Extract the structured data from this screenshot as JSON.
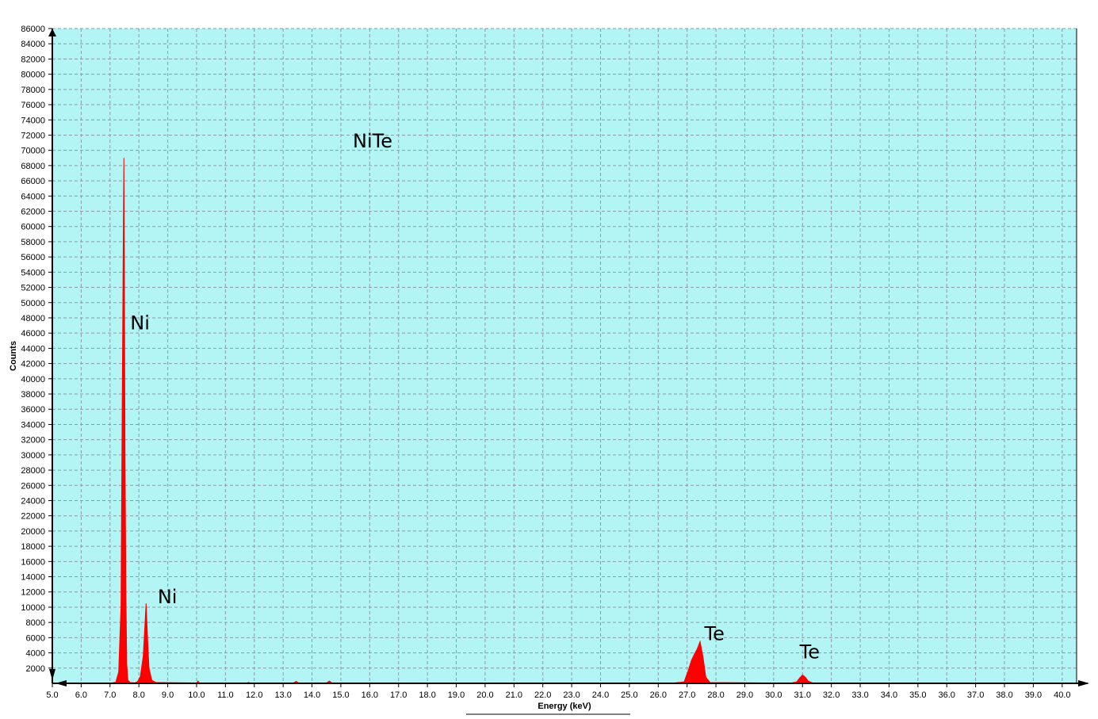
{
  "chart_data": {
    "type": "area",
    "title": "NiTe",
    "xlabel": "Energy (keV)",
    "ylabel": "Counts",
    "xlim": [
      5.0,
      40.5
    ],
    "ylim": [
      0,
      86000
    ],
    "grid": true,
    "plot_background": "#b3f5f5",
    "series_color": "#ff0000",
    "grid_color": "#8a9aa8",
    "x_ticks": [
      5.0,
      6.0,
      7.0,
      8.0,
      9.0,
      10.0,
      11.0,
      12.0,
      13.0,
      14.0,
      15.0,
      16.0,
      17.0,
      18.0,
      19.0,
      20.0,
      21.0,
      22.0,
      23.0,
      24.0,
      25.0,
      26.0,
      27.0,
      28.0,
      29.0,
      30.0,
      31.0,
      32.0,
      33.0,
      34.0,
      35.0,
      36.0,
      37.0,
      38.0,
      39.0,
      40.0
    ],
    "x_tick_labels": [
      "5.0",
      "6.0",
      "7.0",
      "8.0",
      "9.0",
      "10.0",
      "11.0",
      "12.0",
      "13.0",
      "14.0",
      "15.0",
      "16.0",
      "17.0",
      "18.0",
      "19.0",
      "20.0",
      "21.0",
      "22.0",
      "23.0",
      "24.0",
      "25.0",
      "26.0",
      "27.0",
      "28.0",
      "29.0",
      "30.0",
      "31.0",
      "32.0",
      "33.0",
      "34.0",
      "35.0",
      "36.0",
      "37.0",
      "38.0",
      "39.0",
      "40.0"
    ],
    "y_ticks": [
      2000,
      4000,
      6000,
      8000,
      10000,
      12000,
      14000,
      16000,
      18000,
      20000,
      22000,
      24000,
      26000,
      28000,
      30000,
      32000,
      34000,
      36000,
      38000,
      40000,
      42000,
      44000,
      46000,
      48000,
      50000,
      52000,
      54000,
      56000,
      58000,
      60000,
      62000,
      64000,
      66000,
      68000,
      70000,
      72000,
      74000,
      76000,
      78000,
      80000,
      82000,
      84000,
      86000
    ],
    "y_tick_labels": [
      "2000",
      "4000",
      "6000",
      "8000",
      "10000",
      "12000",
      "14000",
      "16000",
      "18000",
      "20000",
      "22000",
      "24000",
      "26000",
      "28000",
      "30000",
      "32000",
      "34000",
      "36000",
      "38000",
      "40000",
      "42000",
      "44000",
      "46000",
      "48000",
      "50000",
      "52000",
      "54000",
      "56000",
      "58000",
      "60000",
      "62000",
      "64000",
      "66000",
      "68000",
      "70000",
      "72000",
      "74000",
      "76000",
      "78000",
      "80000",
      "82000",
      "84000",
      "86000"
    ],
    "series": [
      {
        "x": [
          7.0,
          7.2,
          7.3,
          7.38,
          7.42,
          7.45,
          7.47,
          7.48,
          7.5,
          7.52,
          7.55,
          7.58,
          7.62,
          7.7,
          7.85,
          7.95,
          8.05,
          8.15,
          8.2,
          8.25,
          8.3,
          8.35,
          8.45,
          8.6,
          9.5,
          10.0,
          10.05,
          10.1,
          11.0,
          11.75,
          11.8,
          11.85,
          13.35,
          13.45,
          13.55,
          14.5,
          14.6,
          14.7,
          26.5,
          26.9,
          27.05,
          27.15,
          27.25,
          27.35,
          27.45,
          27.55,
          27.65,
          27.8,
          30.6,
          30.8,
          30.9,
          31.0,
          31.1,
          31.2,
          31.35,
          40.5
        ],
        "y": [
          0,
          150,
          1500,
          10000,
          35000,
          53000,
          64000,
          69000,
          52000,
          30000,
          12000,
          2500,
          400,
          100,
          60,
          200,
          900,
          3500,
          7000,
          10500,
          6000,
          2000,
          400,
          100,
          60,
          50,
          300,
          50,
          40,
          30,
          120,
          30,
          30,
          250,
          30,
          30,
          300,
          30,
          30,
          200,
          1800,
          3000,
          3800,
          4500,
          5500,
          3500,
          800,
          100,
          30,
          200,
          700,
          1100,
          800,
          300,
          50,
          30
        ]
      }
    ],
    "annotations": [
      {
        "text": "Ni",
        "x": 7.7,
        "y": 46500
      },
      {
        "text": "Ni",
        "x": 8.65,
        "y": 10500
      },
      {
        "text": "Te",
        "x": 27.6,
        "y": 5700
      },
      {
        "text": "Te",
        "x": 30.9,
        "y": 3300
      }
    ]
  }
}
